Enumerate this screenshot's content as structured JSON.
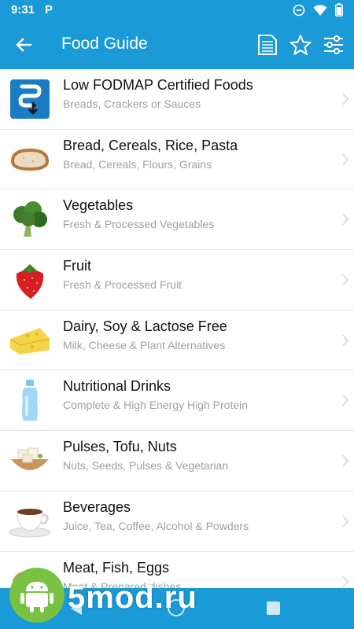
{
  "status_bar": {
    "time": "9:31",
    "notification_icon": "P"
  },
  "app_bar": {
    "title": "Food Guide"
  },
  "icons": {
    "back": "arrow-left-icon",
    "document": "document-icon",
    "favorite": "star-icon",
    "filter": "sliders-icon"
  },
  "colors": {
    "primary": "#1a9ad6",
    "title_text": "#111111",
    "subtitle_text": "#a0a0a0"
  },
  "categories": [
    {
      "name": "Low FODMAP Certified Foods",
      "subtitle": "Breads, Crackers or Sauces",
      "icon": "fodmap-logo-icon"
    },
    {
      "name": "Bread, Cereals, Rice, Pasta",
      "subtitle": "Bread, Cereals, Flours, Grains",
      "icon": "bread-icon"
    },
    {
      "name": "Vegetables",
      "subtitle": "Fresh & Processed Vegetables",
      "icon": "broccoli-icon"
    },
    {
      "name": "Fruit",
      "subtitle": "Fresh & Processed Fruit",
      "icon": "strawberry-icon"
    },
    {
      "name": "Dairy, Soy & Lactose Free",
      "subtitle": "Milk, Cheese & Plant Alternatives",
      "icon": "cheese-icon"
    },
    {
      "name": "Nutritional Drinks",
      "subtitle": "Complete & High Energy High Protein",
      "icon": "bottle-icon"
    },
    {
      "name": "Pulses, Tofu, Nuts",
      "subtitle": "Nuts, Seeds, Pulses & Vegetarian",
      "icon": "tofu-bowl-icon"
    },
    {
      "name": "Beverages",
      "subtitle": "Juice, Tea, Coffee, Alcohol & Powders",
      "icon": "coffee-cup-icon"
    },
    {
      "name": "Meat, Fish, Eggs",
      "subtitle": "Meat & Prepared dishes",
      "icon": "meat-icon"
    }
  ],
  "watermark": {
    "text": "5mod.ru"
  }
}
